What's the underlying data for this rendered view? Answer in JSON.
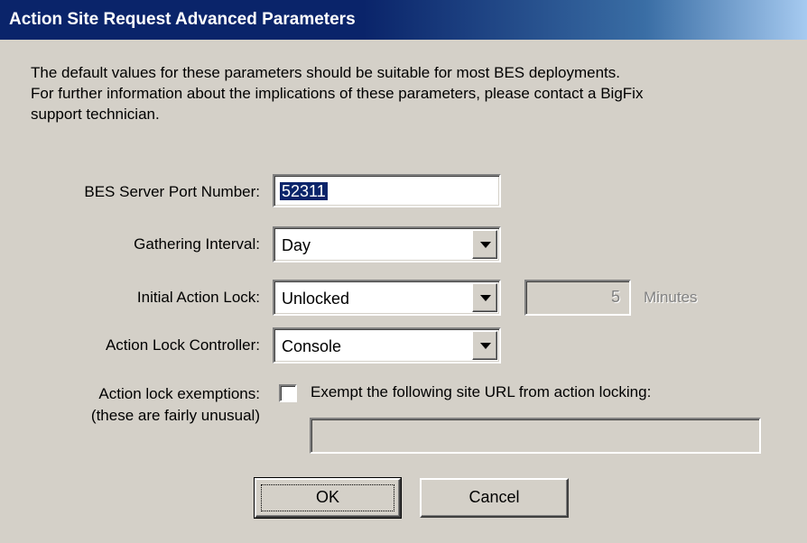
{
  "window": {
    "title": "Action Site Request Advanced Parameters"
  },
  "intro": {
    "line1": "The default values for these parameters should be suitable for most BES deployments.",
    "line2": "For further information about the implications of these parameters, please contact a BigFix",
    "line3": "support technician."
  },
  "fields": {
    "port": {
      "label": "BES Server Port Number:",
      "value": "52311"
    },
    "gathering": {
      "label": "Gathering Interval:",
      "value": "Day"
    },
    "initial_lock": {
      "label": "Initial Action Lock:",
      "value": "Unlocked",
      "minutes_value": "5",
      "minutes_label": "Minutes"
    },
    "lock_controller": {
      "label": "Action Lock Controller:",
      "value": "Console"
    },
    "exemptions": {
      "label_line1": "Action lock exemptions:",
      "label_line2": "(these are fairly unusual)",
      "checkbox_label": "Exempt the following site URL from action locking:",
      "checked": false,
      "url_value": ""
    }
  },
  "buttons": {
    "ok": "OK",
    "cancel": "Cancel"
  },
  "colors": {
    "face": "#d4d0c8",
    "title_start": "#0a246a",
    "title_end": "#a6caf0",
    "selection": "#0a246a"
  }
}
